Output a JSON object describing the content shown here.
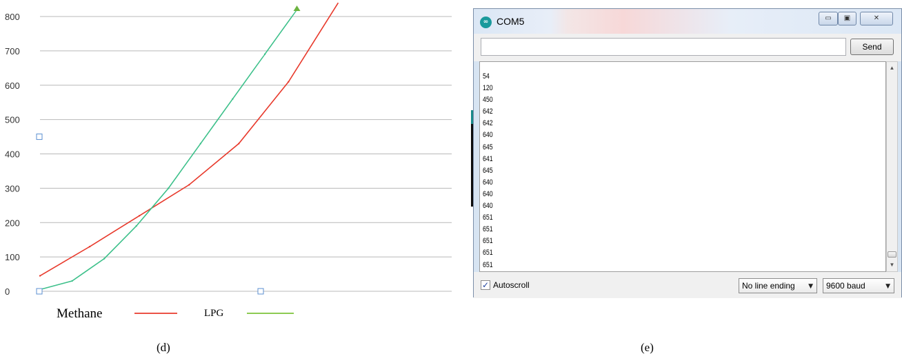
{
  "chart_data": {
    "type": "line",
    "ylim": [
      0,
      800
    ],
    "yticks": [
      "800",
      "700",
      "600",
      "500",
      "400",
      "300",
      "200",
      "100",
      "0"
    ],
    "legend_position": "bottom-left",
    "grid": true,
    "series": [
      {
        "name": "Methane",
        "color": "#e8392b",
        "x": [
          0,
          1,
          2,
          3,
          4,
          5,
          6
        ],
        "y": [
          45,
          130,
          220,
          310,
          430,
          610,
          840
        ]
      },
      {
        "name": "LPG",
        "color": "#3cc08a",
        "x": [
          0,
          1,
          2,
          3,
          4,
          5,
          6,
          7,
          8
        ],
        "y": [
          5,
          30,
          95,
          190,
          300,
          430,
          560,
          690,
          820
        ]
      }
    ],
    "legend_colors": {
      "Methane": "#e8392b",
      "LPG": "#7cc23a"
    }
  },
  "captions": {
    "left": "(d)",
    "right": "(e)"
  },
  "serial_monitor": {
    "title": "COM5",
    "icon": "arduino-icon",
    "window_buttons": {
      "minimize": "▭",
      "maximize": "▣",
      "close": "✕"
    },
    "input_value": "",
    "send_label": "Send",
    "lines": [
      "54",
      "120",
      "450",
      "642",
      "642",
      "640",
      "645",
      "641",
      "645",
      "640",
      "640",
      "640",
      "651",
      "651",
      "651",
      "651",
      "651"
    ],
    "autoscroll_label": "Autoscroll",
    "autoscroll_checked": true,
    "line_ending": "No line ending",
    "baud": "9600 baud"
  }
}
